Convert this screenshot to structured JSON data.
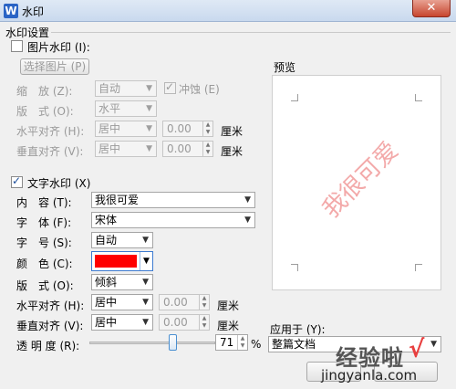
{
  "window": {
    "title": "水印",
    "app_icon": "W",
    "close_glyph": "✕"
  },
  "settings_group": {
    "label": "水印设置"
  },
  "picture_watermark": {
    "checkbox_label": "图片水印 (I):",
    "checked": false,
    "select_button": "选择图片 (P)",
    "scale_label": "缩　放 (Z):",
    "scale_value": "自动",
    "washout_label": "冲蚀 (E)",
    "washout_checked": true,
    "layout_label": "版　式 (O):",
    "layout_value": "水平",
    "h_align_label": "水平对齐 (H):",
    "h_align_value": "居中",
    "h_offset": "0.00",
    "h_unit": "厘米",
    "v_align_label": "垂直对齐 (V):",
    "v_align_value": "居中",
    "v_offset": "0.00",
    "v_unit": "厘米"
  },
  "text_watermark": {
    "checkbox_label": "文字水印 (X)",
    "checked": true,
    "content_label": "内　容 (T):",
    "content_value": "我很可爱",
    "font_label": "字　体 (F):",
    "font_value": "宋体",
    "size_label": "字　号 (S):",
    "size_value": "自动",
    "color_label": "颜　色 (C):",
    "color_value": "#ff0000",
    "layout_label": "版　式 (O):",
    "layout_value": "倾斜",
    "h_align_label": "水平对齐 (H):",
    "h_align_value": "居中",
    "h_offset": "0.00",
    "h_unit": "厘米",
    "v_align_label": "垂直对齐 (V):",
    "v_align_value": "居中",
    "v_offset": "0.00",
    "v_unit": "厘米",
    "transparency_label": "透 明 度 (R):",
    "transparency_value": "71",
    "transparency_unit": "%"
  },
  "preview": {
    "label": "预览",
    "watermark_text": "我很可爱"
  },
  "apply_to": {
    "label": "应用于 (Y):",
    "value": "整篇文档"
  },
  "overlay": {
    "logo_text": "经验啦",
    "check_glyph": "√",
    "url": "jingyanla.com"
  },
  "colors": {
    "accent_blue": "#1b4d9a",
    "watermark_pink": "#f3a9a9",
    "swatch_red": "#ff0000"
  }
}
